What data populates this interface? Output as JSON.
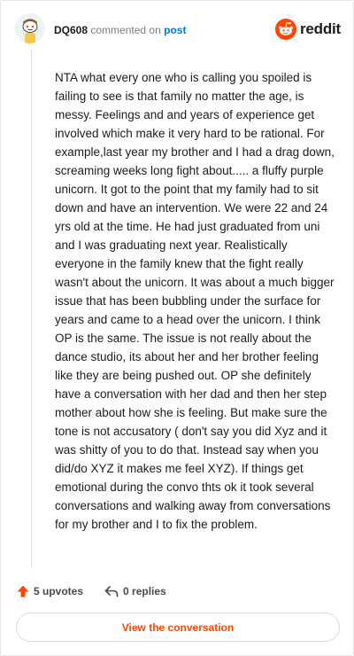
{
  "header": {
    "username": "DQ608",
    "commented_on": "commented on",
    "post_link": "post",
    "logo_text": "reddit"
  },
  "comment": {
    "body": "NTA what every one who is calling you spoiled is failing to see is that family no matter the age, is messy. Feelings and and years of experience get involved which make it very hard to be rational. For example,last year my brother and I had a drag down, screaming weeks long fight about..... a fluffy purple unicorn. It got to the point that my family had to sit down and have an intervention. We were 22 and 24 yrs old at the time. He had just graduated from uni and I was graduating next year. Realistically everyone in the family knew that the fight really wasn't about the unicorn. It was about a much bigger issue that has been bubbling under the surface for years and came to a head over the unicorn. I think OP is the same. The issue is not really about the dance studio, its about her and her brother feeling like they are being pushed out. OP she definitely have a conversation with her dad and then her step mother about how she is feeling. But make sure the tone is not accusatory ( don't say you did Xyz and it was shitty of you to do that. Instead say when you did/do XYZ it makes me feel XYZ). If things get emotional during the convo thts ok it took several conversations and walking away from conversations for my brother and I to fix the problem."
  },
  "actions": {
    "upvotes": "5 upvotes",
    "replies": "0 replies",
    "upvote_icon": "upvote-arrow-icon",
    "reply_icon": "reply-arrow-icon"
  },
  "view_button": "View the conversation",
  "colors": {
    "accent": "#ff4500",
    "link": "#0079d3",
    "text": "#1c1c1c",
    "muted": "#7c7c7c"
  }
}
